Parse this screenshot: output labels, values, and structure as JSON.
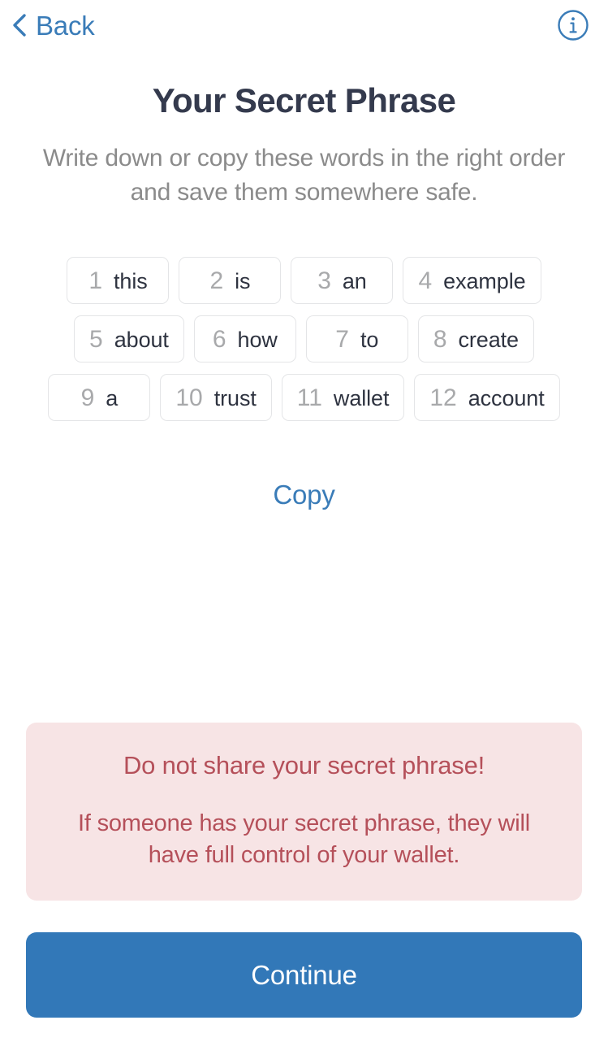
{
  "navbar": {
    "back_label": "Back",
    "back_icon": "chevron-left-icon",
    "info_icon": "info-circle-icon",
    "accent_color": "#3a7cb8"
  },
  "header": {
    "title": "Your Secret Phrase",
    "subtitle": "Write down or copy these words in the right order and save them somewhere safe.",
    "title_color": "#343a4d",
    "subtitle_color": "#8b8b8b"
  },
  "secret_phrase": {
    "word_count": 12,
    "words": [
      {
        "index": "1",
        "word": "this"
      },
      {
        "index": "2",
        "word": "is"
      },
      {
        "index": "3",
        "word": "an"
      },
      {
        "index": "4",
        "word": "example"
      },
      {
        "index": "5",
        "word": "about"
      },
      {
        "index": "6",
        "word": "how"
      },
      {
        "index": "7",
        "word": "to"
      },
      {
        "index": "8",
        "word": "create"
      },
      {
        "index": "9",
        "word": "a"
      },
      {
        "index": "10",
        "word": "trust"
      },
      {
        "index": "11",
        "word": "wallet"
      },
      {
        "index": "12",
        "word": "account"
      }
    ],
    "chip_border_color": "#e4e5e7",
    "index_color": "#a8a9ab",
    "word_color": "#2e3340"
  },
  "copy": {
    "label": "Copy",
    "color": "#3a7cb8"
  },
  "warning": {
    "title": "Do not share your secret phrase!",
    "body": "If someone has your secret phrase, they will have full control of your wallet.",
    "background_color": "#f7e4e5",
    "text_color": "#b5505a"
  },
  "footer": {
    "continue_label": "Continue",
    "continue_background": "#3278b8",
    "continue_text_color": "#ffffff"
  }
}
